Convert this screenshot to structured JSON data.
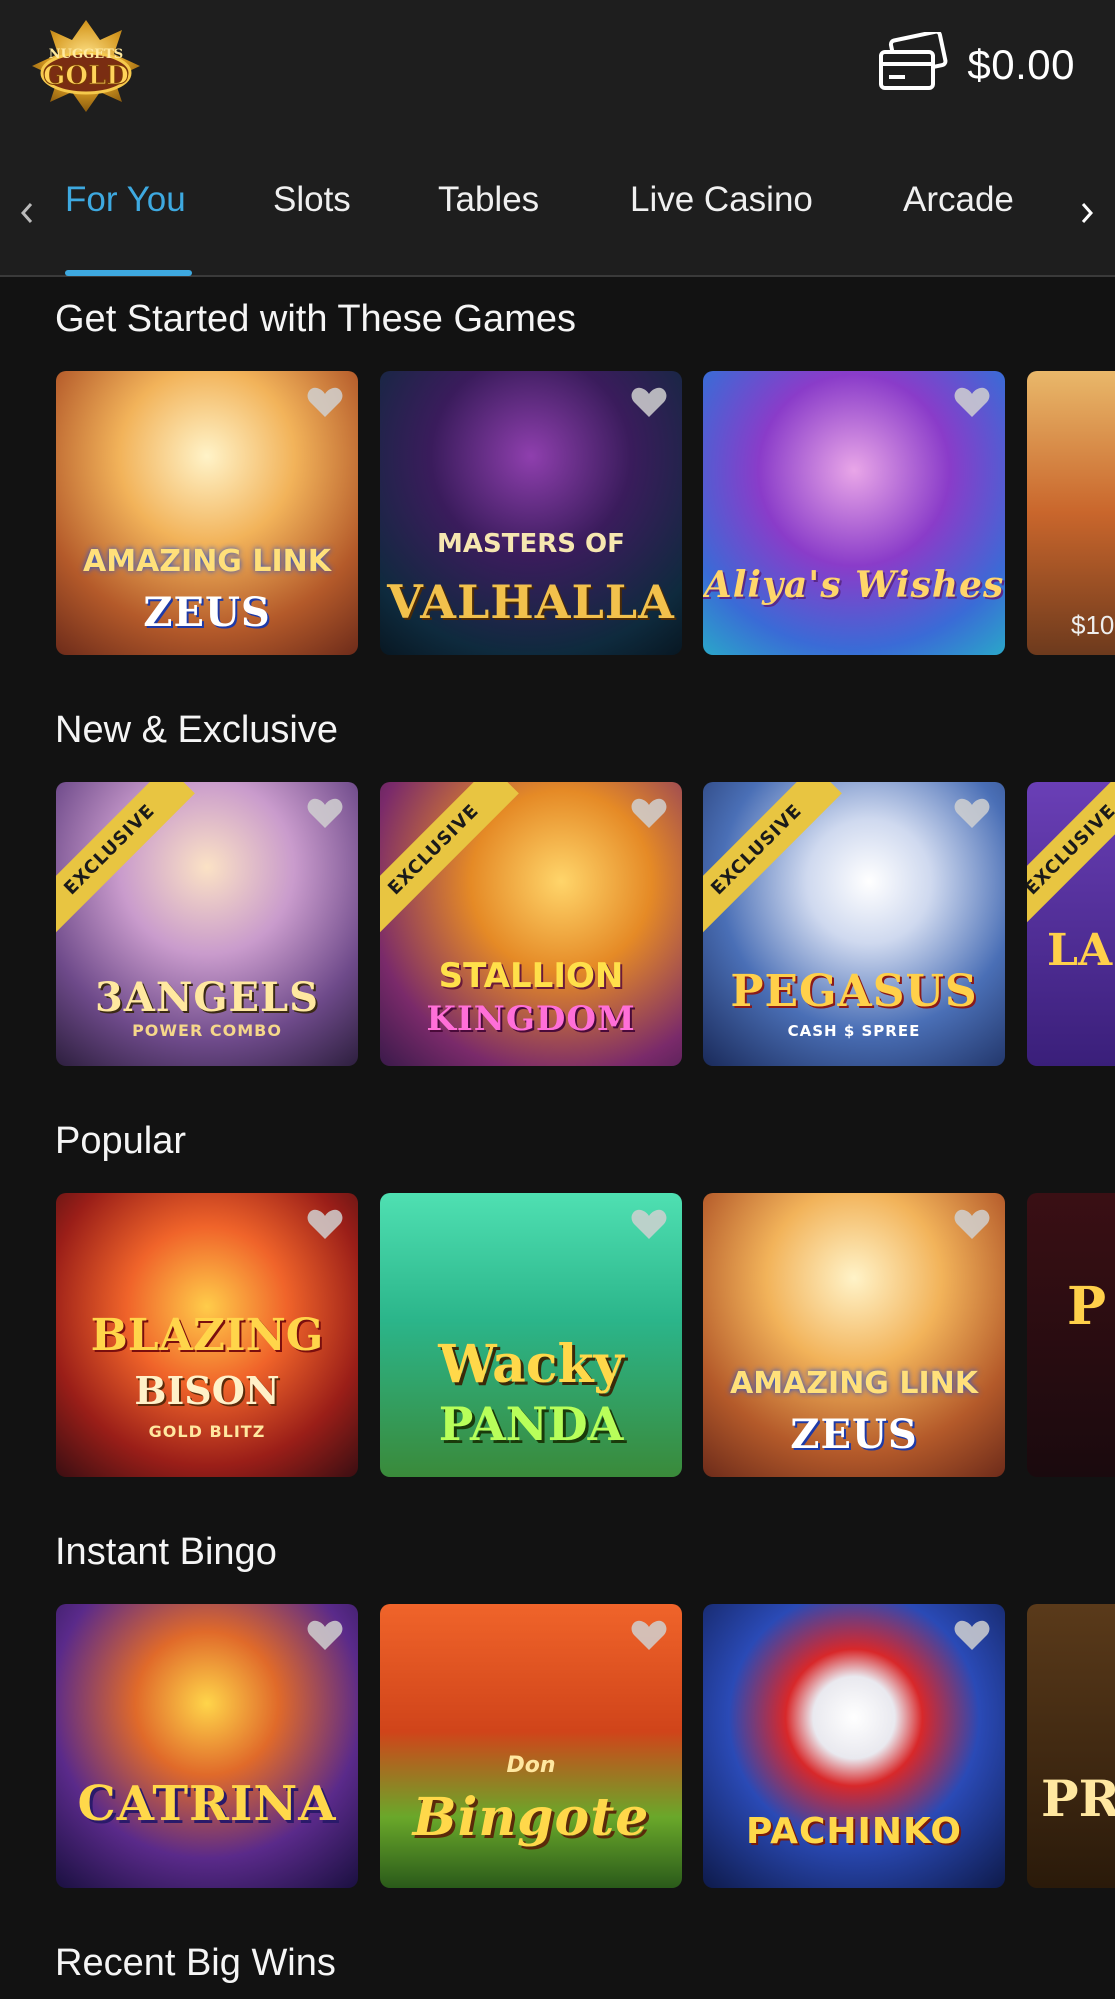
{
  "header": {
    "logo_text_top": "NUGGETS",
    "logo_text_main": "GOLD",
    "balance": "$0.00",
    "wallet_icon": "credit-card-wallet-icon"
  },
  "tabs": [
    {
      "label": "For You",
      "active": true
    },
    {
      "label": "Slots",
      "active": false
    },
    {
      "label": "Tables",
      "active": false
    },
    {
      "label": "Live Casino",
      "active": false
    },
    {
      "label": "Arcade",
      "active": false
    }
  ],
  "sections": {
    "get_started": {
      "title": "Get Started with These Games",
      "games": [
        {
          "name": "AMAZING LINK",
          "sub": "ZEUS"
        },
        {
          "name": "MASTERS OF",
          "sub": "VALHALLA"
        },
        {
          "name": "Aliya's Wishes",
          "sub": ""
        },
        {
          "peek_label": "$10"
        }
      ]
    },
    "new_exclusive": {
      "title": "New & Exclusive",
      "ribbon": "EXCLUSIVE",
      "games": [
        {
          "name": "3ANGELS",
          "sub": "POWER COMBO"
        },
        {
          "name": "STALLION",
          "sub": "KINGDOM"
        },
        {
          "name": "PEGASUS",
          "sub": "CASH $ SPREE"
        },
        {
          "name": "LA"
        }
      ]
    },
    "popular": {
      "title": "Popular",
      "games": [
        {
          "name": "BLAZING",
          "sub": "BISON",
          "extra": "GOLD BLITZ"
        },
        {
          "name": "Wacky",
          "sub": "PANDA"
        },
        {
          "name": "AMAZING LINK",
          "sub": "ZEUS"
        },
        {
          "name": "P"
        }
      ]
    },
    "instant_bingo": {
      "title": "Instant Bingo",
      "games": [
        {
          "name": "CATRINA",
          "sub": ""
        },
        {
          "name": "Bingote",
          "sub": "Don"
        },
        {
          "name": "PACHINKO",
          "sub": ""
        },
        {
          "name": "PR"
        }
      ]
    },
    "recent_wins": {
      "title": "Recent Big Wins"
    }
  }
}
